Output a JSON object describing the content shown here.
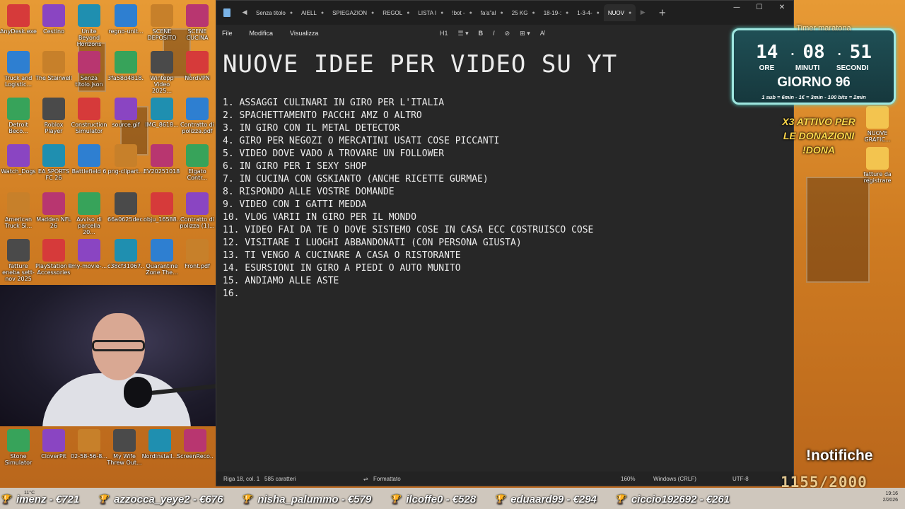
{
  "desktop": {
    "icons_col1": [
      "AnyDesk.exe",
      "Truck and Logistic...",
      "Detroit Beco...",
      "Watch_Dogs",
      "American Truck Si...",
      "fatture eneba sett-nov 2025"
    ],
    "icons_col2": [
      "Cestino",
      "The Stairwell",
      "Roblox Player",
      "EA SPORTS FC 26",
      "Madden NFL 26",
      "PlayStation® Accessories"
    ],
    "icons_col3": [
      "Unite Beyond Horizons",
      "Senza titolo.json",
      "Construction Simulator",
      "Battlefield 6",
      "Avviso di parcella 20...",
      "my-movie-..."
    ],
    "icons_col4": [
      "regno-unit...",
      "3fa58d4818...",
      "source.gif",
      "png-clipart...",
      "66a0625dec...",
      "c38cf31067..."
    ],
    "icons_col5": [
      "SCENE DEPOSITO",
      "Wintepp Video 2025...",
      "IMG_8618...",
      "EV20251018...",
      "obju_16588...",
      "Quarantine Zone The..."
    ],
    "icons_col6": [
      "SCENE CUCINA",
      "NordVPN",
      "Contratto di polizza.pdf",
      "Elgato Contr...",
      "Contratto di polizza (1)...",
      "Front.pdf"
    ],
    "icons_right": [
      "NUOVE GRAFIC...",
      "fatture da registrare"
    ],
    "icons_bottom": [
      "Stone Simulator",
      "CloverPit",
      "02-58-56-8...",
      "My Wife Threw Out...",
      "NordInstall...",
      "ScreenReco..."
    ]
  },
  "notepad": {
    "tabs": [
      {
        "label": "Senza titolo",
        "active": false
      },
      {
        "label": "AIELL",
        "active": false
      },
      {
        "label": "SPIEGAZION",
        "active": false
      },
      {
        "label": "REGOL",
        "active": false
      },
      {
        "label": "LISTA I",
        "active": false
      },
      {
        "label": "!bot -",
        "active": false
      },
      {
        "label": "fa'a\"al",
        "active": false
      },
      {
        "label": "25 KG",
        "active": false
      },
      {
        "label": "18-19-:",
        "active": false
      },
      {
        "label": "1-3-4-",
        "active": false
      },
      {
        "label": "NUOV",
        "active": true
      }
    ],
    "menu": [
      "File",
      "Modifica",
      "Visualizza"
    ],
    "heading_level": "H1",
    "title": "NUOVE IDEE PER VIDEO SU YT",
    "lines": [
      "1. ASSAGGI CULINARI IN GIRO PER L'ITALIA",
      "2. SPACHETTAMENTO PACCHI AMZ O ALTRO",
      "3. IN GIRO CON IL METAL DETECTOR",
      "4. GIRO PER NEGOZI O MERCATINI USATI COSE PICCANTI",
      "5. VIDEO DOVE VADO A TROVARE UN FOLLOWER",
      "6. IN GIRO PER I SEXY SHOP",
      "7. IN CUCINA CON GSKIANTO (ANCHE RICETTE GURMAE)",
      "8. RISPONDO ALLE VOSTRE DOMANDE",
      "9. VIDEO CON I GATTI MEDDA",
      "10. VLOG VARII IN GIRO PER IL MONDO",
      "11. VIDEO FAI DA TE O DOVE SISTEMO COSE IN CASA ECC COSTRUISCO COSE",
      "12. VISITARE I LUOGHI ABBANDONATI (CON PERSONA GIUSTA)",
      "13. TI VENGO A CUCINARE A CASA O RISTORANTE",
      "14. ESURSIONI IN GIRO A PIEDI O AUTO MUNITO",
      "15. ANDIAMO ALLE ASTE",
      "16."
    ],
    "status": {
      "position": "Riga 18, col. 1",
      "chars": "585 caratteri",
      "format": "Formattato",
      "zoom": "160%",
      "eol": "Windows (CRLF)",
      "encoding": "UTF-8"
    }
  },
  "overlay": {
    "timer_title": "Timer maratona",
    "hours": "14",
    "minutes": "08",
    "seconds": "51",
    "hours_label": "ORE",
    "minutes_label": "MINUTI",
    "seconds_label": "SECONDI",
    "day": "GIORNO 96",
    "rates": "1 sub = 6min - 1€ = 3min - 100 bits = 2min",
    "x3_line1": "X3 ATTIVO PER",
    "x3_line2": "LE DONAZIONI",
    "x3_line3": "!DONA",
    "notifiche": "!notifiche",
    "progress": "1155/2000"
  },
  "ticker": [
    "imenz - €721",
    "azzocca_yeye2 - €676",
    "nisha_palummo - €579",
    "ilcoffe0 - €528",
    "eduaard99 - €294",
    "ciccio192692 - €261"
  ],
  "taskbar": {
    "weather": "11°C",
    "time": "19:16",
    "date": "2/2026"
  },
  "colors": {
    "accent_timer": "#9ee6df",
    "donation_yellow": "#ffd84a",
    "editor_bg": "#272727"
  }
}
